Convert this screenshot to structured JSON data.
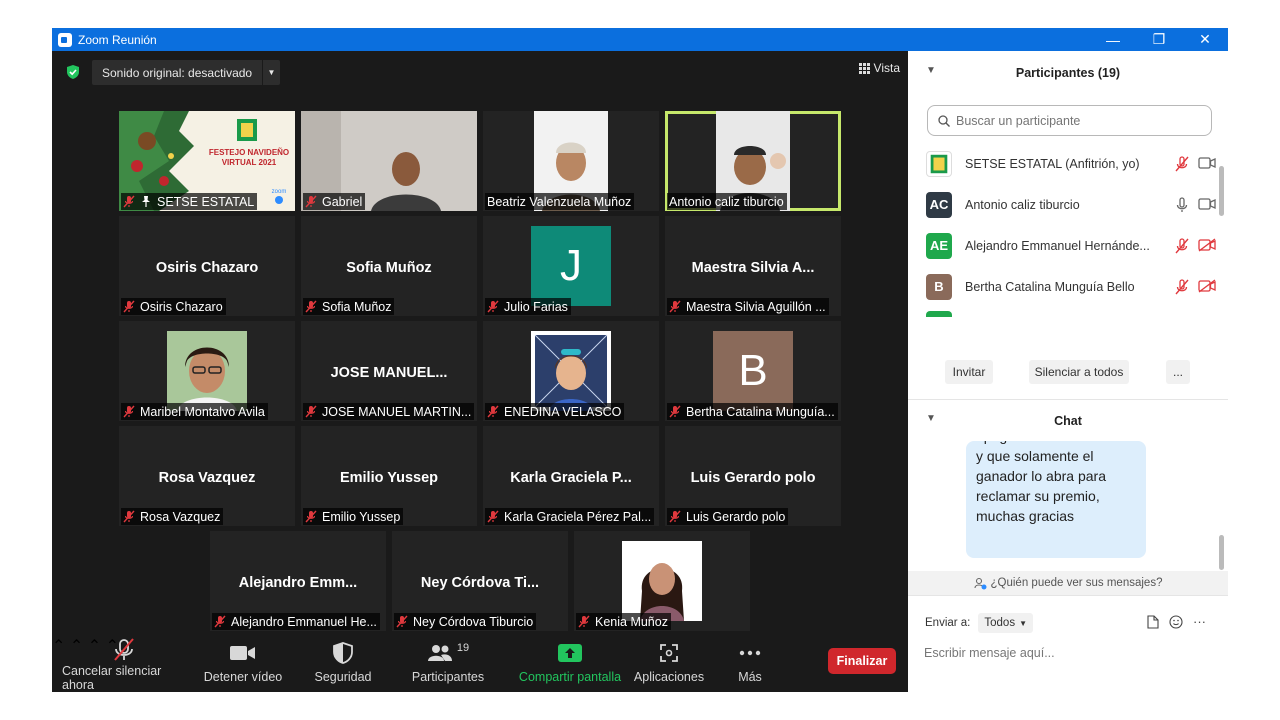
{
  "window": {
    "title": "Zoom Reunión",
    "controls": [
      "—",
      "❐",
      "✕"
    ]
  },
  "top": {
    "sound_label": "Sonido original: desactivado",
    "view_label": "Vista"
  },
  "tiles": [
    {
      "label": "SETSE ESTATAL",
      "pinned": true
    },
    {
      "label": "Gabriel"
    },
    {
      "label": "Beatriz Valenzuela Muñoz"
    },
    {
      "label": "Antonio caliz tiburcio"
    },
    {
      "name": "Osiris Chazaro",
      "label": "Osiris Chazaro"
    },
    {
      "name": "Sofia Muñoz",
      "label": "Sofia Muñoz"
    },
    {
      "initial": "J",
      "label": "Julio Farias",
      "color": "#0e8a78"
    },
    {
      "name": "Maestra Silvia A...",
      "label": "Maestra Silvia Aguillón ..."
    },
    {
      "label": "Maribel Montalvo Avila"
    },
    {
      "name": "JOSE MANUEL...",
      "label": "JOSE MANUEL MARTIN..."
    },
    {
      "label": "ENEDINA VELASCO"
    },
    {
      "initial": "B",
      "label": "Bertha Catalina Munguía...",
      "color": "#8a6a5a"
    },
    {
      "name": "Rosa Vazquez",
      "label": "Rosa Vazquez"
    },
    {
      "name": "Emilio Yussep",
      "label": "Emilio Yussep"
    },
    {
      "name": "Karla Graciela P...",
      "label": "Karla Graciela Pérez Pal..."
    },
    {
      "name": "Luis Gerardo polo",
      "label": "Luis Gerardo polo"
    },
    {
      "name": "Alejandro Emm...",
      "label": "Alejandro Emmanuel He..."
    },
    {
      "name": "Ney Córdova Ti...",
      "label": "Ney Córdova Tiburcio"
    },
    {
      "label": "Kenia Muñoz"
    }
  ],
  "banner": {
    "line1": "FESTEJO NAVIDEÑO",
    "line2": "VIRTUAL 2021",
    "zoom": "zoom"
  },
  "toolbar": {
    "mute": "Cancelar silenciar ahora",
    "video": "Detener vídeo",
    "security": "Seguridad",
    "participants": "Participantes",
    "participants_count": "19",
    "share": "Compartir pantalla",
    "apps": "Aplicaciones",
    "more": "Más",
    "end": "Finalizar"
  },
  "participants_panel": {
    "title": "Participantes (19)",
    "search_placeholder": "Buscar un participante",
    "rows": [
      {
        "initials": "",
        "name": "SETSE ESTATAL (Anfitrión, yo)",
        "color": "#ffffff"
      },
      {
        "initials": "AC",
        "name": "Antonio caliz tiburcio",
        "color": "#2f3a45"
      },
      {
        "initials": "AE",
        "name": "Alejandro Emmanuel Hernánde...",
        "color": "#1fa84c"
      },
      {
        "initials": "B",
        "name": "Bertha Catalina Munguía Bello",
        "color": "#8a6a5a"
      }
    ],
    "invite": "Invitar",
    "mute_all": "Silenciar a todos",
    "more": "..."
  },
  "chat": {
    "title": "Chat",
    "message": "apagados sus micrófonos y que solamente el ganador lo abra para reclamar su premio, muchas gracias",
    "who_sees": "¿Quién puede ver sus mensajes?",
    "send_to_label": "Enviar a:",
    "send_to_value": "Todos",
    "placeholder": "Escribir mensaje aquí..."
  },
  "colors": {
    "titlebar": "#0b6fde",
    "accent_green": "#22c55e",
    "end_red": "#d0272c",
    "active_outline": "#c6e86b"
  }
}
